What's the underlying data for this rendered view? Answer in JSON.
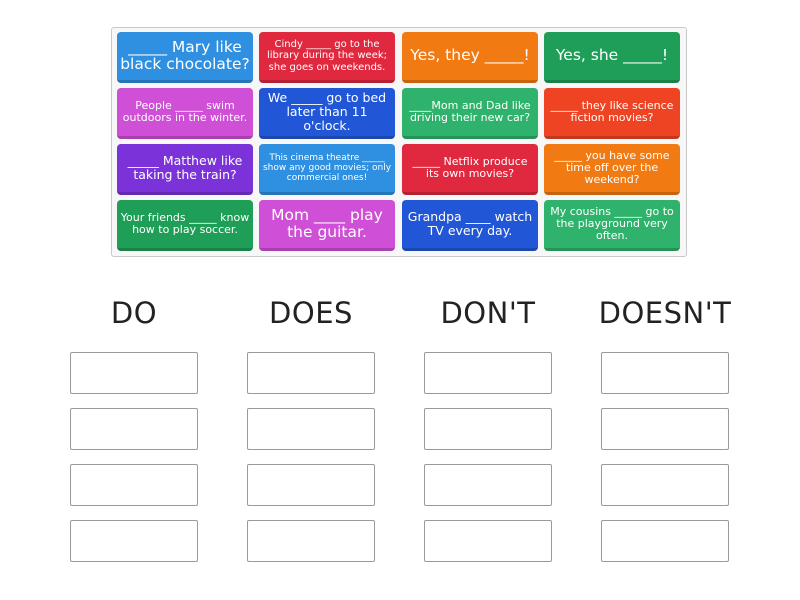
{
  "cards": [
    {
      "text": "_____ Mary like black chocolate?",
      "color": "#2f8fe0"
    },
    {
      "text": "Cindy _____ go to the library during the week; she goes on weekends.",
      "color": "#e0283f"
    },
    {
      "text": "Yes, they _____!",
      "color": "#f27a12"
    },
    {
      "text": "Yes, she _____!",
      "color": "#1f9e58"
    },
    {
      "text": "People _____ swim outdoors in the winter.",
      "color": "#cf4fd6"
    },
    {
      "text": "We _____ go to bed later than 11 o'clock.",
      "color": "#2157d6"
    },
    {
      "text": "____Mom and Dad like driving their new car?",
      "color": "#2fb36c"
    },
    {
      "text": "_____ they like science fiction movies?",
      "color": "#ee4423"
    },
    {
      "text": "_____ Matthew like taking the train?",
      "color": "#7b32d8"
    },
    {
      "text": "This cinema theatre _____ show any good movies; only commercial ones!",
      "color": "#2f8fe0"
    },
    {
      "text": "_____ Netflix produce its own movies?",
      "color": "#e0283f"
    },
    {
      "text": "_____ you have some time off over the weekend?",
      "color": "#f27a12"
    },
    {
      "text": "Your friends _____ know how to play soccer.",
      "color": "#1f9e58"
    },
    {
      "text": "Mom ____ play the guitar.",
      "color": "#cf4fd6"
    },
    {
      "text": "Grandpa ____ watch TV every day.",
      "color": "#2157d6"
    },
    {
      "text": "My cousins _____ go to the playground very often.",
      "color": "#2fb36c"
    }
  ],
  "columns": [
    {
      "label": "DO"
    },
    {
      "label": "DOES"
    },
    {
      "label": "DON'T"
    },
    {
      "label": "DOESN'T"
    }
  ],
  "slots_per_column": 4
}
